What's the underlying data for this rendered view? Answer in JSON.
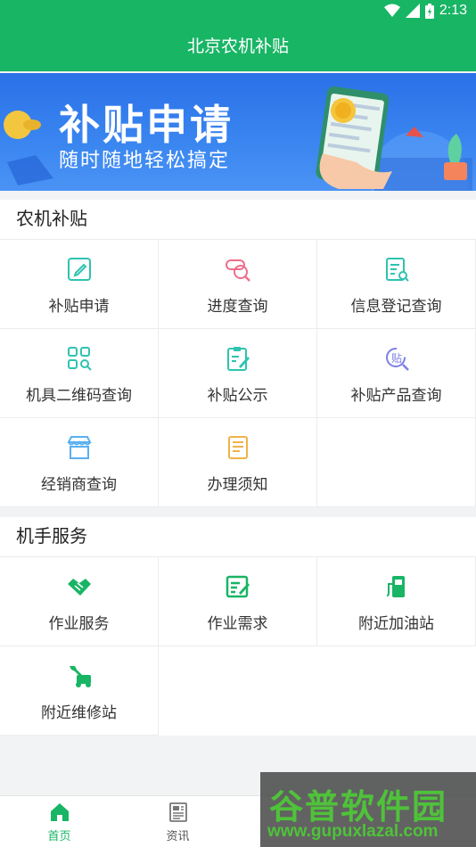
{
  "status": {
    "time": "2:13"
  },
  "header": {
    "title": "北京农机补贴"
  },
  "banner": {
    "title": "补贴申请",
    "subtitle": "随时随地轻松搞定"
  },
  "sections": [
    {
      "title": "农机补贴",
      "items": [
        {
          "label": "补贴申请",
          "icon": "edit-icon"
        },
        {
          "label": "进度查询",
          "icon": "search-progress-icon"
        },
        {
          "label": "信息登记查询",
          "icon": "document-search-icon"
        },
        {
          "label": "机具二维码查询",
          "icon": "qrcode-search-icon"
        },
        {
          "label": "补贴公示",
          "icon": "clipboard-edit-icon"
        },
        {
          "label": "补贴产品查询",
          "icon": "product-search-icon"
        },
        {
          "label": "经销商查询",
          "icon": "store-icon"
        },
        {
          "label": "办理须知",
          "icon": "notice-icon"
        }
      ]
    },
    {
      "title": "机手服务",
      "items": [
        {
          "label": "作业服务",
          "icon": "handshake-icon"
        },
        {
          "label": "作业需求",
          "icon": "form-edit-icon"
        },
        {
          "label": "附近加油站",
          "icon": "gas-station-icon"
        },
        {
          "label": "附近维修站",
          "icon": "wrench-tractor-icon"
        }
      ]
    }
  ],
  "tabs": [
    {
      "label": "首页",
      "icon": "home-icon",
      "active": true
    },
    {
      "label": "资讯",
      "icon": "news-icon",
      "active": false
    }
  ],
  "watermark": {
    "brand": "谷普软件园",
    "url": "www.gupuxlazal.com"
  },
  "colors": {
    "primary": "#18b565",
    "banner": "#3a86f0",
    "pink": "#ee6e8c",
    "purple": "#7d7fe8",
    "teal": "#2ec3b0",
    "orange": "#f0b24a",
    "blue": "#5ab0f0"
  }
}
